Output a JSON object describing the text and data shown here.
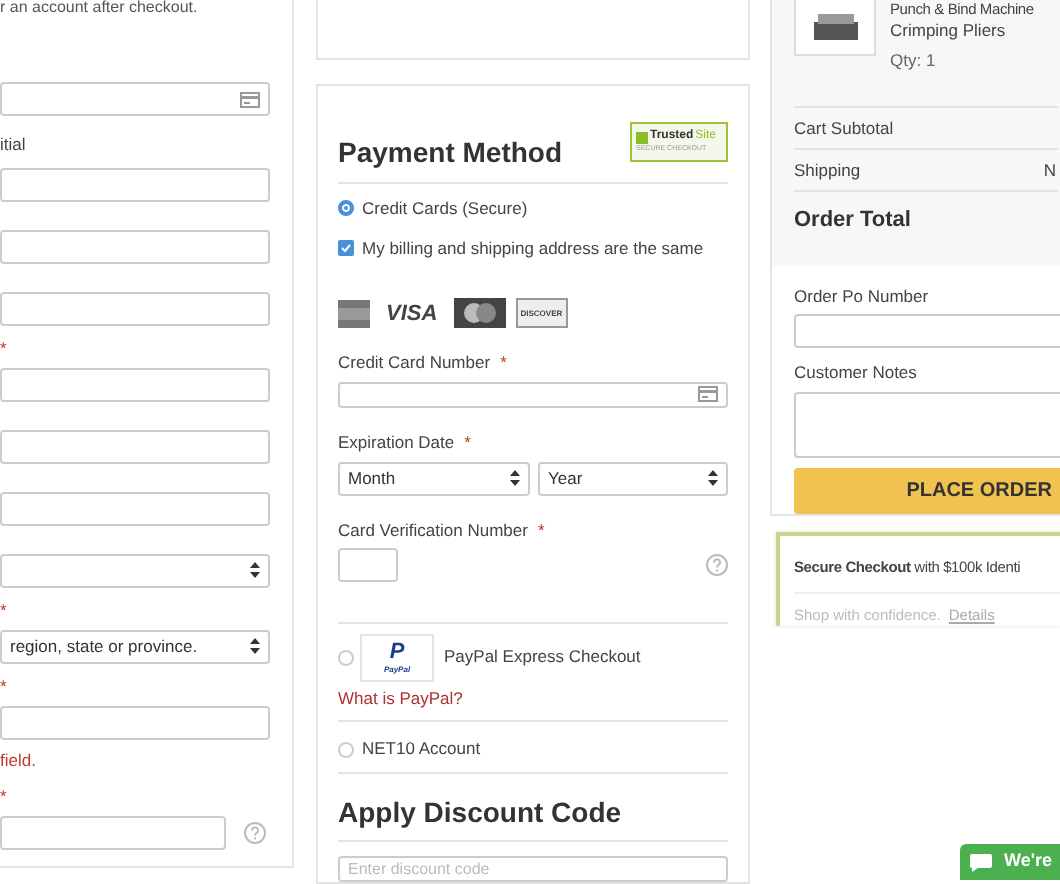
{
  "billing": {
    "note": "r an account after checkout.",
    "items": [
      {
        "kind": "card-field"
      },
      {
        "kind": "label",
        "text": "itial"
      },
      {
        "kind": "field"
      },
      {
        "kind": "field"
      },
      {
        "kind": "field"
      },
      {
        "kind": "mark",
        "text": "*"
      },
      {
        "kind": "field"
      },
      {
        "kind": "field"
      },
      {
        "kind": "field"
      },
      {
        "kind": "select"
      },
      {
        "kind": "mark",
        "text": "*"
      },
      {
        "kind": "select",
        "value": "region, state or province."
      },
      {
        "kind": "mark",
        "text": "*"
      },
      {
        "kind": "field"
      },
      {
        "kind": "error",
        "text": "field."
      },
      {
        "kind": "mark",
        "text": "*"
      },
      {
        "kind": "help-field"
      }
    ]
  },
  "payment": {
    "title": "Payment Method",
    "badge": {
      "line1": "Trusted",
      "line1b": "Site",
      "line2": "SECURE CHECKOUT"
    },
    "credit_card_option": {
      "label": "Credit Cards (Secure)",
      "selected": true
    },
    "same_address": {
      "label": "My billing and shipping address are the same",
      "checked": true
    },
    "card_logos": [
      {
        "kind": "amex"
      },
      {
        "kind": "visa",
        "text": "VISA"
      },
      {
        "kind": "mastercard"
      },
      {
        "kind": "discover",
        "text": "DISCOVER"
      }
    ],
    "card_number": {
      "label": "Credit Card Number",
      "required": true
    },
    "expiration": {
      "label": "Expiration Date",
      "required": true,
      "month": "Month",
      "year": "Year"
    },
    "cvv": {
      "label": "Card Verification Number",
      "required": true
    },
    "paypal_option": {
      "label": "PayPal Express Checkout",
      "logo_mark": "P",
      "logo_text": "PayPal",
      "link": "What is PayPal?",
      "selected": false
    },
    "net10_option": {
      "label": "NET10 Account",
      "selected": false
    }
  },
  "discount": {
    "title": "Apply Discount Code",
    "placeholder": "Enter discount code"
  },
  "summary": {
    "product": {
      "name": "Punch & Bind Machine",
      "name2": "Crimping Pliers",
      "qty": "Qty: 1"
    },
    "rows": [
      {
        "label": "Cart Subtotal"
      },
      {
        "label": "Shipping",
        "value": "N"
      }
    ],
    "total_label": "Order Total",
    "po_label": "Order Po Number",
    "notes_label": "Customer Notes",
    "button": "PLACE ORDER"
  },
  "secure": {
    "text": "**Secure Checkout** with $100k Identi",
    "sub": "Shop with confidence.",
    "link": "Details"
  },
  "chat": {
    "label": "We're"
  }
}
